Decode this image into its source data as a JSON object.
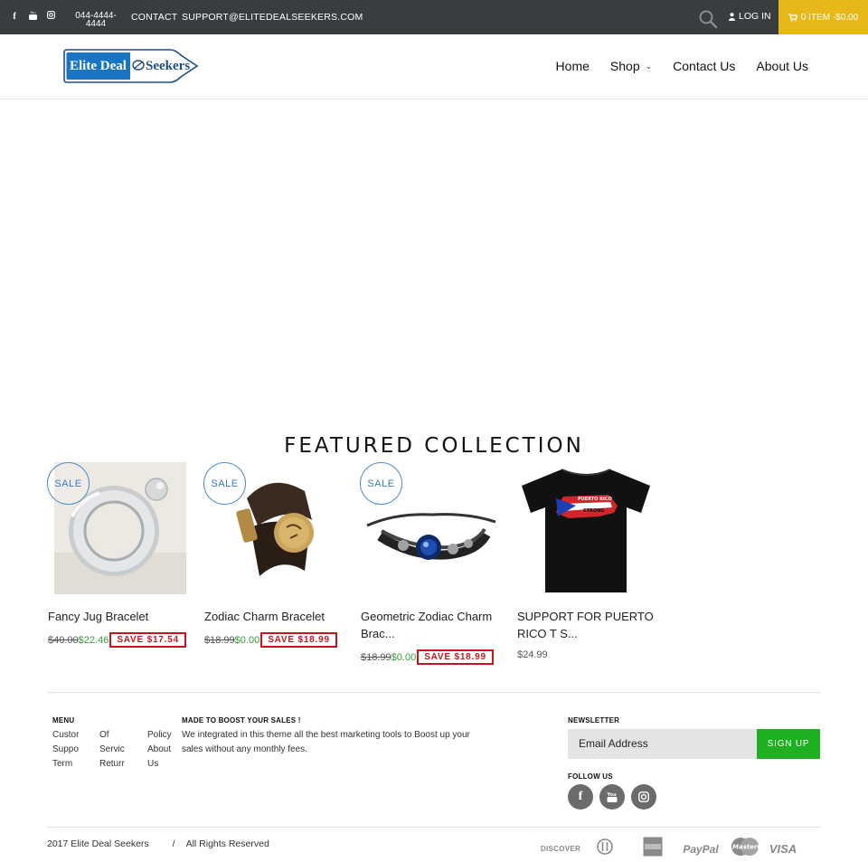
{
  "topbar": {
    "social_icons": [
      "facebook-icon",
      "youtube-icon",
      "instagram-icon"
    ],
    "phone": "044-4444-4444",
    "contact_label": "CONTACT",
    "email": "SUPPORT@ELITEDEALSEEKERS.COM",
    "login_label": "LOG IN",
    "cart_label": "0 ITEM -$0.00",
    "cart_color": "#e8b818",
    "bg_color": "#3a3d40"
  },
  "header": {
    "logo_text_left": "Elite Deal",
    "logo_text_right": "Seekers",
    "nav": [
      "Home",
      "Shop",
      "Contact Us",
      "About Us"
    ]
  },
  "featured": {
    "title": "FEATURED COLLECTION",
    "products": [
      {
        "name": "Fancy Jug Bracelet",
        "sale_badge": "SALE",
        "old_price": "$40.00",
        "price": "$22.46",
        "save": "SAVE $17.54"
      },
      {
        "name": "Zodiac Charm Bracelet",
        "sale_badge": "SALE",
        "old_price": "$18.99",
        "price": "$0.00",
        "save": "SAVE $18.99"
      },
      {
        "name": "Geometric Zodiac Charm Brac...",
        "sale_badge": "SALE",
        "old_price": "$18.99",
        "price": "$0.00",
        "save": "SAVE $18.99"
      },
      {
        "name": "SUPPORT FOR PUERTO RICO T S...",
        "price": "$24.99",
        "shirt_text_top": "PUERTO RICO",
        "shirt_text_bottom": "STRONG"
      }
    ]
  },
  "footer": {
    "menu_heading": "MENU",
    "menu_links": [
      "Custor",
      "Of",
      "Policy",
      "Suppo",
      "Servic",
      "About",
      "Term",
      "Returr",
      "Us"
    ],
    "boost_heading": "MADE TO BOOST YOUR SALES !",
    "boost_text": "We integrated in this theme all the best marketing tools to Boost up your sales without any monthly fees.",
    "newsletter_heading": "NEWSLETTER",
    "email_placeholder": "Email Address",
    "signup_label": "SIGN UP",
    "follow_heading": "FOLLOW US",
    "follow_icons": [
      "facebook-icon",
      "youtube-icon",
      "instagram-icon"
    ],
    "copyright": "2017 Elite Deal Seekers",
    "separator": "/",
    "rights": "All Rights Reserved",
    "payments": [
      "DISCOVER",
      "diners-club-icon",
      "amex-icon",
      "PayPal",
      "MasterCard",
      "VISA"
    ],
    "signup_color": "#1fb022"
  }
}
